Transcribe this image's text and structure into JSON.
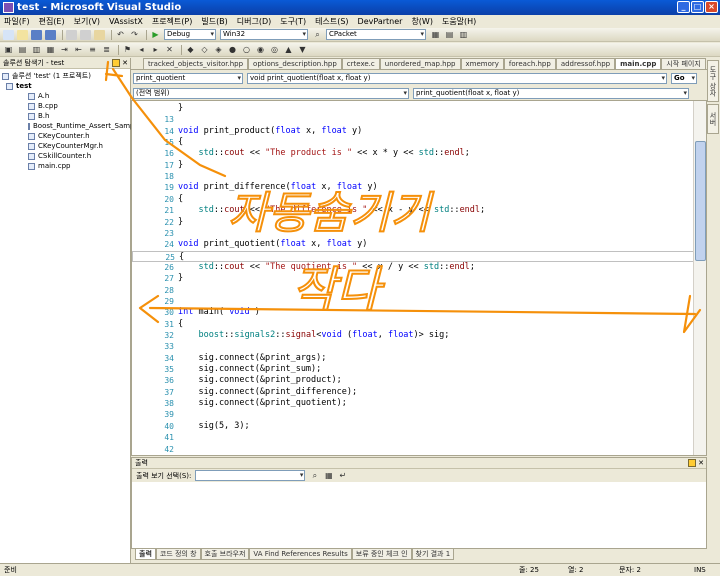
{
  "window": {
    "title": "test - Microsoft Visual Studio",
    "controls": [
      "_",
      "□",
      "×"
    ]
  },
  "menu": [
    "파일(F)",
    "편집(E)",
    "보기(V)",
    "VAssistX",
    "프로젝트(P)",
    "빌드(B)",
    "디버그(D)",
    "도구(T)",
    "테스트(S)",
    "DevPartner",
    "창(W)",
    "도움말(H)"
  ],
  "toolbar": {
    "config": "Debug",
    "platform": "Win32",
    "search": "CPacket"
  },
  "solution_explorer": {
    "title": "솔루션 탐색기 - test",
    "items": [
      {
        "label": "솔루션 'test' (1 프로젝트)",
        "bold": false
      },
      {
        "label": "test",
        "bold": true
      },
      {
        "label": "A.h",
        "bold": false
      },
      {
        "label": "B.cpp",
        "bold": false
      },
      {
        "label": "B.h",
        "bold": false
      },
      {
        "label": "Boost_Runtime_Assert_Sample",
        "bold": false
      },
      {
        "label": "CKeyCounter.h",
        "bold": false
      },
      {
        "label": "CKeyCounterMgr.h",
        "bold": false
      },
      {
        "label": "CSkillCounter.h",
        "bold": false
      },
      {
        "label": "main.cpp",
        "bold": false
      }
    ]
  },
  "right_tabs": [
    "도구 상자",
    "서버"
  ],
  "doc_tabs": [
    "tracked_objects_visitor.hpp",
    "options_description.hpp",
    "crtexe.c",
    "unordered_map.hpp",
    "xmemory",
    "foreach.hpp",
    "addressof.hpp",
    "main.cpp",
    "시작 페이지"
  ],
  "active_tab": "main.cpp",
  "navigation": {
    "member_combo": "print_quotient",
    "function_combo": "void print_quotient(float x, float y)",
    "go_label": "Go",
    "scope_combo": "(전역 범위)",
    "scope_member_combo": "print_quotient(float x, float y)"
  },
  "code": [
    {
      "n": "",
      "text": "}"
    },
    {
      "n": "13",
      "text": ""
    },
    {
      "n": "14",
      "text": "void print_product(float x, float y)"
    },
    {
      "n": "15",
      "text": "{"
    },
    {
      "n": "16",
      "text": "    std::cout << \"The product is \" << x * y << std::endl;"
    },
    {
      "n": "17",
      "text": "}"
    },
    {
      "n": "18",
      "text": ""
    },
    {
      "n": "19",
      "text": "void print_difference(float x, float y)"
    },
    {
      "n": "20",
      "text": "{"
    },
    {
      "n": "21",
      "text": "    std::cout << \"The difference is \" << x - y << std::endl;"
    },
    {
      "n": "22",
      "text": "}"
    },
    {
      "n": "23",
      "text": ""
    },
    {
      "n": "24",
      "text": "void print_quotient(float x, float y)"
    },
    {
      "n": "25",
      "text": "{"
    },
    {
      "n": "26",
      "text": "    std::cout << \"The quotient is \" << x / y << std::endl;"
    },
    {
      "n": "27",
      "text": "}"
    },
    {
      "n": "28",
      "text": ""
    },
    {
      "n": "29",
      "text": ""
    },
    {
      "n": "30",
      "text": "int main( void )"
    },
    {
      "n": "31",
      "text": "{"
    },
    {
      "n": "32",
      "text": "    boost::signals2::signal<void (float, float)> sig;"
    },
    {
      "n": "33",
      "text": ""
    },
    {
      "n": "34",
      "text": "    sig.connect(&print_args);"
    },
    {
      "n": "35",
      "text": "    sig.connect(&print_sum);"
    },
    {
      "n": "36",
      "text": "    sig.connect(&print_product);"
    },
    {
      "n": "37",
      "text": "    sig.connect(&print_difference);"
    },
    {
      "n": "38",
      "text": "    sig.connect(&print_quotient);"
    },
    {
      "n": "39",
      "text": ""
    },
    {
      "n": "40",
      "text": "    sig(5, 3);"
    },
    {
      "n": "41",
      "text": ""
    },
    {
      "n": "42",
      "text": ""
    }
  ],
  "output": {
    "title": "출력",
    "source_label": "출력 보기 선택(S):"
  },
  "bottom_tabs": [
    "출력",
    "코드 정의 창",
    "호출 브라우저",
    "VA Find References Results",
    "보류 중인 체크 인",
    "찾기 결과 1"
  ],
  "status": {
    "ready": "준비",
    "line": "줄: 25",
    "col": "열: 2",
    "char": "문자: 2",
    "mode": "INS"
  },
  "annotation_handwriting": [
    "자동숨기기",
    "작다"
  ],
  "annotation_color": "#f5900a"
}
